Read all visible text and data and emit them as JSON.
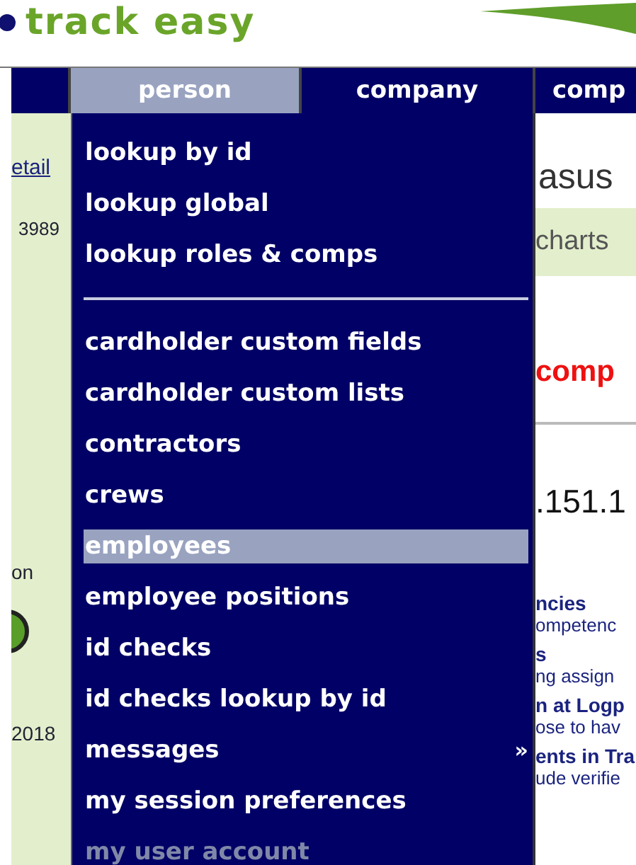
{
  "logo": {
    "text": "track easy"
  },
  "nav": [
    {
      "label": "person",
      "selected": true
    },
    {
      "label": "company",
      "selected": false
    },
    {
      "label": "comp",
      "selected": false
    }
  ],
  "menu": {
    "items": [
      {
        "kind": "item",
        "label": "lookup by id",
        "selected": false,
        "disabled": false
      },
      {
        "kind": "item",
        "label": "lookup global",
        "selected": false,
        "disabled": false
      },
      {
        "kind": "item",
        "label": "lookup roles & comps",
        "selected": false,
        "disabled": false
      },
      {
        "kind": "separator"
      },
      {
        "kind": "item",
        "label": "cardholder custom fields",
        "selected": false,
        "disabled": false
      },
      {
        "kind": "item",
        "label": "cardholder custom lists",
        "selected": false,
        "disabled": false
      },
      {
        "kind": "item",
        "label": "contractors",
        "selected": false,
        "disabled": false
      },
      {
        "kind": "item",
        "label": "crews",
        "selected": false,
        "disabled": false
      },
      {
        "kind": "item",
        "label": "employees",
        "selected": true,
        "disabled": false
      },
      {
        "kind": "item",
        "label": "employee positions",
        "selected": false,
        "disabled": false
      },
      {
        "kind": "item",
        "label": "id checks",
        "selected": false,
        "disabled": false
      },
      {
        "kind": "item",
        "label": "id checks lookup by id",
        "selected": false,
        "disabled": false
      },
      {
        "kind": "item",
        "label": "messages",
        "selected": false,
        "disabled": false,
        "arrow": "»"
      },
      {
        "kind": "item",
        "label": "my session preferences",
        "selected": false,
        "disabled": false
      },
      {
        "kind": "item",
        "label": "my user account",
        "selected": false,
        "disabled": true
      }
    ]
  },
  "sidebar": {
    "link": "etail",
    "number": "3989",
    "label": "on",
    "year": "2018"
  },
  "content": {
    "title": "asus",
    "tab": "charts",
    "alert": "comp",
    "heading": ".151.1",
    "entries": [
      {
        "title": "ncies",
        "text": "ompetenc"
      },
      {
        "title": "s",
        "text": "ng assign"
      },
      {
        "title": "n at Logp",
        "text": "ose to hav"
      },
      {
        "title": "ents in Tra",
        "text": "ude verifie"
      }
    ]
  }
}
